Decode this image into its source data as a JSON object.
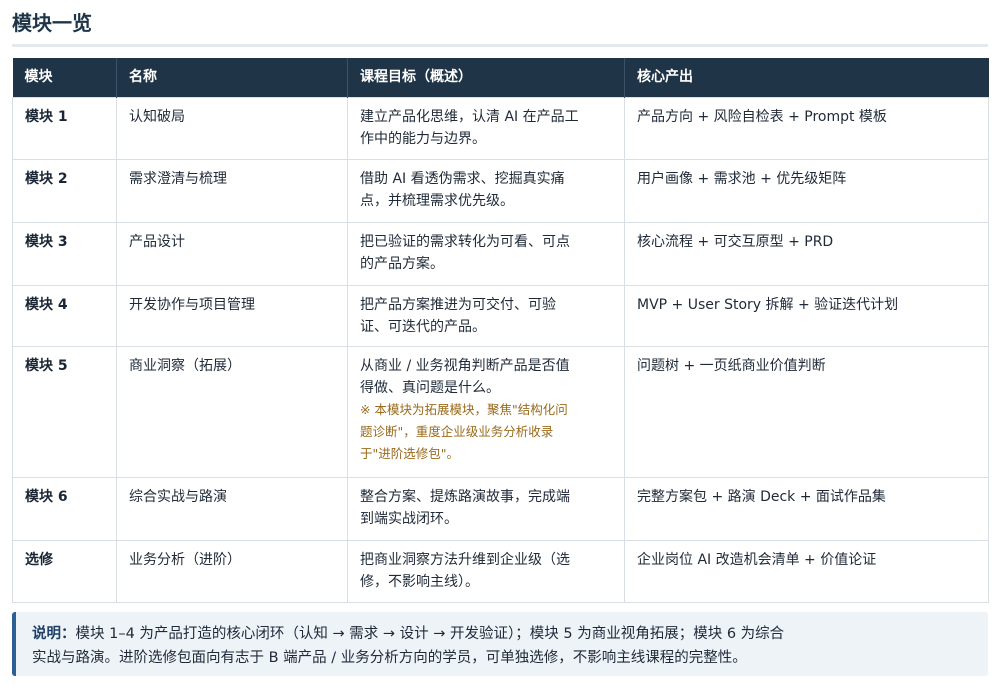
{
  "title": "模块一览",
  "table": {
    "headers": [
      "模块",
      "名称",
      "课程目标（概述）",
      "核心产出"
    ],
    "rows": [
      {
        "module": "模块 1",
        "name": "认知破局",
        "goal": [
          "建立产品化思维，认清 AI 在产品工",
          "作中的能力与边界。"
        ],
        "output": "产品方向 + 风险自检表 + Prompt 模板"
      },
      {
        "module": "模块 2",
        "name": "需求澄清与梳理",
        "goal": [
          "借助 AI 看透伪需求、挖掘真实痛",
          "点，并梳理需求优先级。"
        ],
        "output": "用户画像 + 需求池 + 优先级矩阵"
      },
      {
        "module": "模块 3",
        "name": "产品设计",
        "goal": [
          "把已验证的需求转化为可看、可点",
          "的产品方案。"
        ],
        "output": "核心流程 + 可交互原型 + PRD"
      },
      {
        "module": "模块 4",
        "name": "开发协作与项目管理",
        "goal": [
          "把产品方案推进为可交付、可验",
          "证、可迭代的产品。"
        ],
        "output": "MVP + User Story 拆解 + 验证迭代计划"
      },
      {
        "module": "模块 5",
        "name": "商业洞察（拓展）",
        "goal": [
          "从商业 / 业务视角判断产品是否值",
          "得做、真问题是什么。"
        ],
        "note": [
          "※ 本模块为拓展模块，聚焦\"结构化问",
          "题诊断\"，重度企业级业务分析收录",
          "于\"进阶选修包\"。"
        ],
        "output": "问题树 + 一页纸商业价值判断"
      },
      {
        "module": "模块 6",
        "name": "综合实战与路演",
        "goal": [
          "整合方案、提炼路演故事，完成端",
          "到端实战闭环。"
        ],
        "output": "完整方案包 + 路演 Deck + 面试作品集"
      },
      {
        "module": "选修",
        "name": "业务分析（进阶）",
        "goal": [
          "把商业洞察方法升维到企业级（选",
          "修，不影响主线）。"
        ],
        "output": "企业岗位 AI 改造机会清单 + 价值论证"
      }
    ]
  },
  "explain": {
    "label": "说明：",
    "line1": "模块 1–4 为产品打造的核心闭环（认知 → 需求 → 设计 → 开发验证）；模块 5 为商业视角拓展；模块 6 为综合",
    "line2": "实战与路演。进阶选修包面向有志于 B 端产品 / 业务分析方向的学员，可单独选修，不影响主线课程的完整性。"
  }
}
